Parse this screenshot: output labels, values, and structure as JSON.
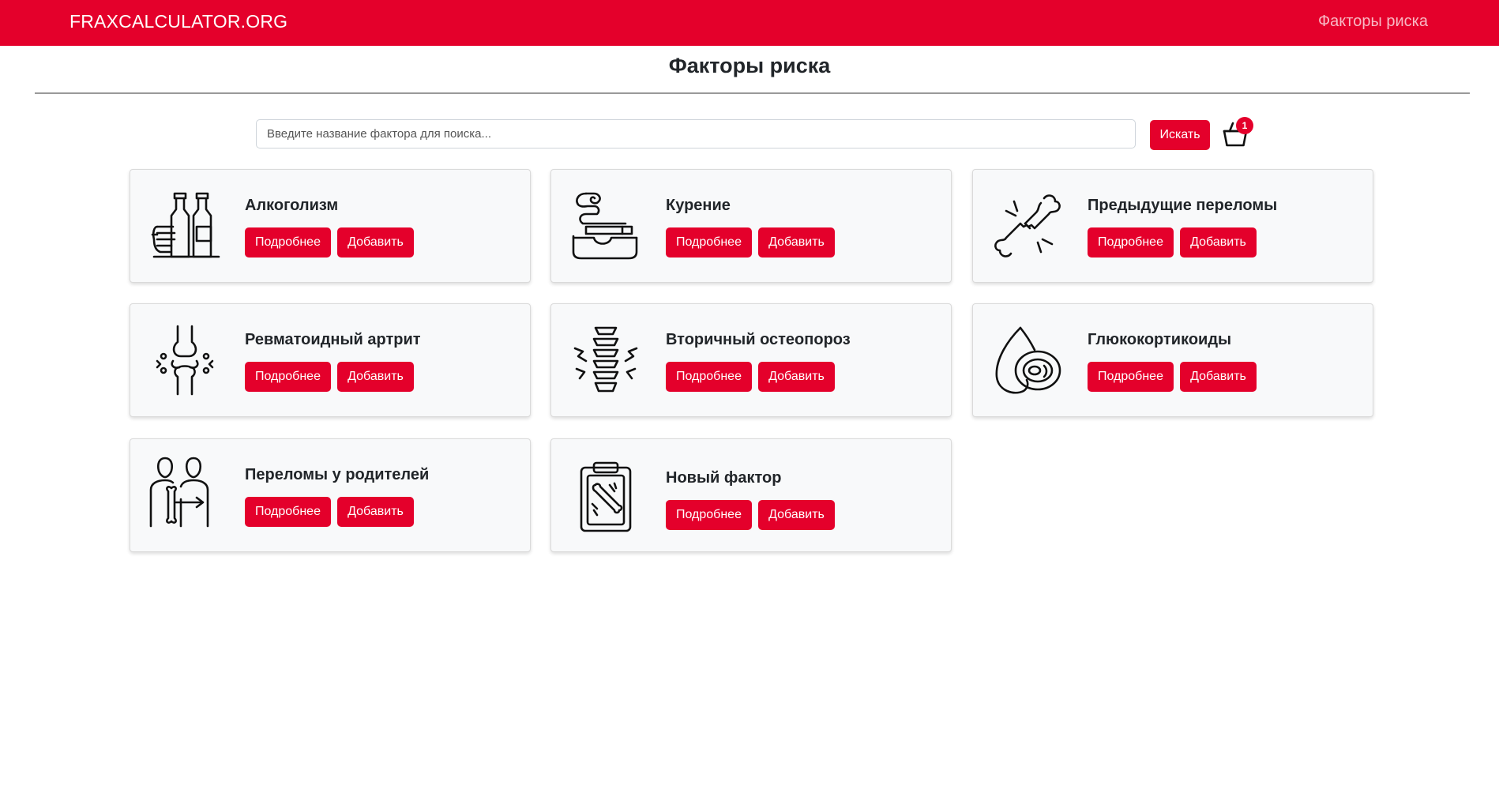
{
  "navbar": {
    "brand": "FRAXCALCULATOR.ORG",
    "link": "Факторы риска",
    "color": "#e4002b"
  },
  "page": {
    "title": "Факторы риска"
  },
  "search": {
    "placeholder": "Введите название фактора для поиска...",
    "value": "",
    "button_label": "Искать"
  },
  "cart": {
    "icon": "basket-icon",
    "count": "1"
  },
  "cards": [
    {
      "title": "Алкоголизм",
      "icon": "alcohol-bottles-icon",
      "more_label": "Подробнее",
      "add_label": "Добавить"
    },
    {
      "title": "Курение",
      "icon": "smoking-icon",
      "more_label": "Подробнее",
      "add_label": "Добавить"
    },
    {
      "title": "Предыдущие переломы",
      "icon": "broken-bone-icon",
      "more_label": "Подробнее",
      "add_label": "Добавить"
    },
    {
      "title": "Ревматоидный артрит",
      "icon": "knee-joint-icon",
      "more_label": "Подробнее",
      "add_label": "Добавить"
    },
    {
      "title": "Вторичный остеопороз",
      "icon": "spine-icon",
      "more_label": "Подробнее",
      "add_label": "Добавить"
    },
    {
      "title": "Глюкокортикоиды",
      "icon": "adrenal-gland-icon",
      "more_label": "Подробнее",
      "add_label": "Добавить"
    },
    {
      "title": "Переломы у родителей",
      "icon": "parents-bone-icon",
      "more_label": "Подробнее",
      "add_label": "Добавить"
    },
    {
      "title": "Новый фактор",
      "icon": "clipboard-bone-icon",
      "more_label": "Подробнее",
      "add_label": "Добавить"
    }
  ]
}
